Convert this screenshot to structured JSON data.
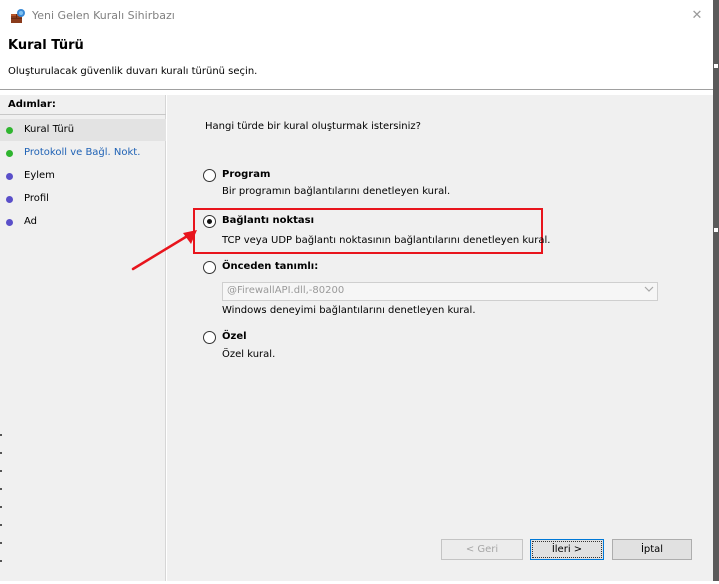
{
  "window": {
    "title": "Yeni Gelen Kuralı Sihirbazı",
    "close_glyph": "✕"
  },
  "header": {
    "title": "Kural Türü",
    "subtitle": "Oluşturulacak güvenlik duvarı kuralı türünü seçin."
  },
  "sidebar": {
    "heading": "Adımlar:",
    "steps": [
      {
        "label": "Kural Türü",
        "status": "completed",
        "active": true,
        "dot_color": "#2fb52f"
      },
      {
        "label": "Protokoll ve Bağl. Nokt.",
        "status": "completed",
        "active": false,
        "dot_color": "#2fb52f"
      },
      {
        "label": "Eylem",
        "status": "pending",
        "active": false,
        "dot_color": "#5a4fc9"
      },
      {
        "label": "Profil",
        "status": "pending",
        "active": false,
        "dot_color": "#5a4fc9"
      },
      {
        "label": "Ad",
        "status": "pending",
        "active": false,
        "dot_color": "#5a4fc9"
      }
    ]
  },
  "main": {
    "question": "Hangi türde bir kural oluşturmak istersiniz?",
    "options": [
      {
        "label": "Program",
        "description": "Bir programın bağlantılarını denetleyen kural.",
        "selected": false
      },
      {
        "label": "Bağlantı noktası",
        "description": "TCP veya UDP bağlantı noktasının bağlantılarını denetleyen kural.",
        "selected": true
      },
      {
        "label": "Önceden tanımlı:",
        "description": "Windows deneyimi bağlantılarını denetleyen kural.",
        "selected": false,
        "select_value": "@FirewallAPI.dll,-80200"
      },
      {
        "label": "Özel",
        "description": "Özel kural.",
        "selected": false
      }
    ]
  },
  "buttons": {
    "back": "< Geri",
    "next": "İleri >",
    "cancel": "İptal"
  },
  "annotation": {
    "highlight_color": "#e8141c"
  }
}
